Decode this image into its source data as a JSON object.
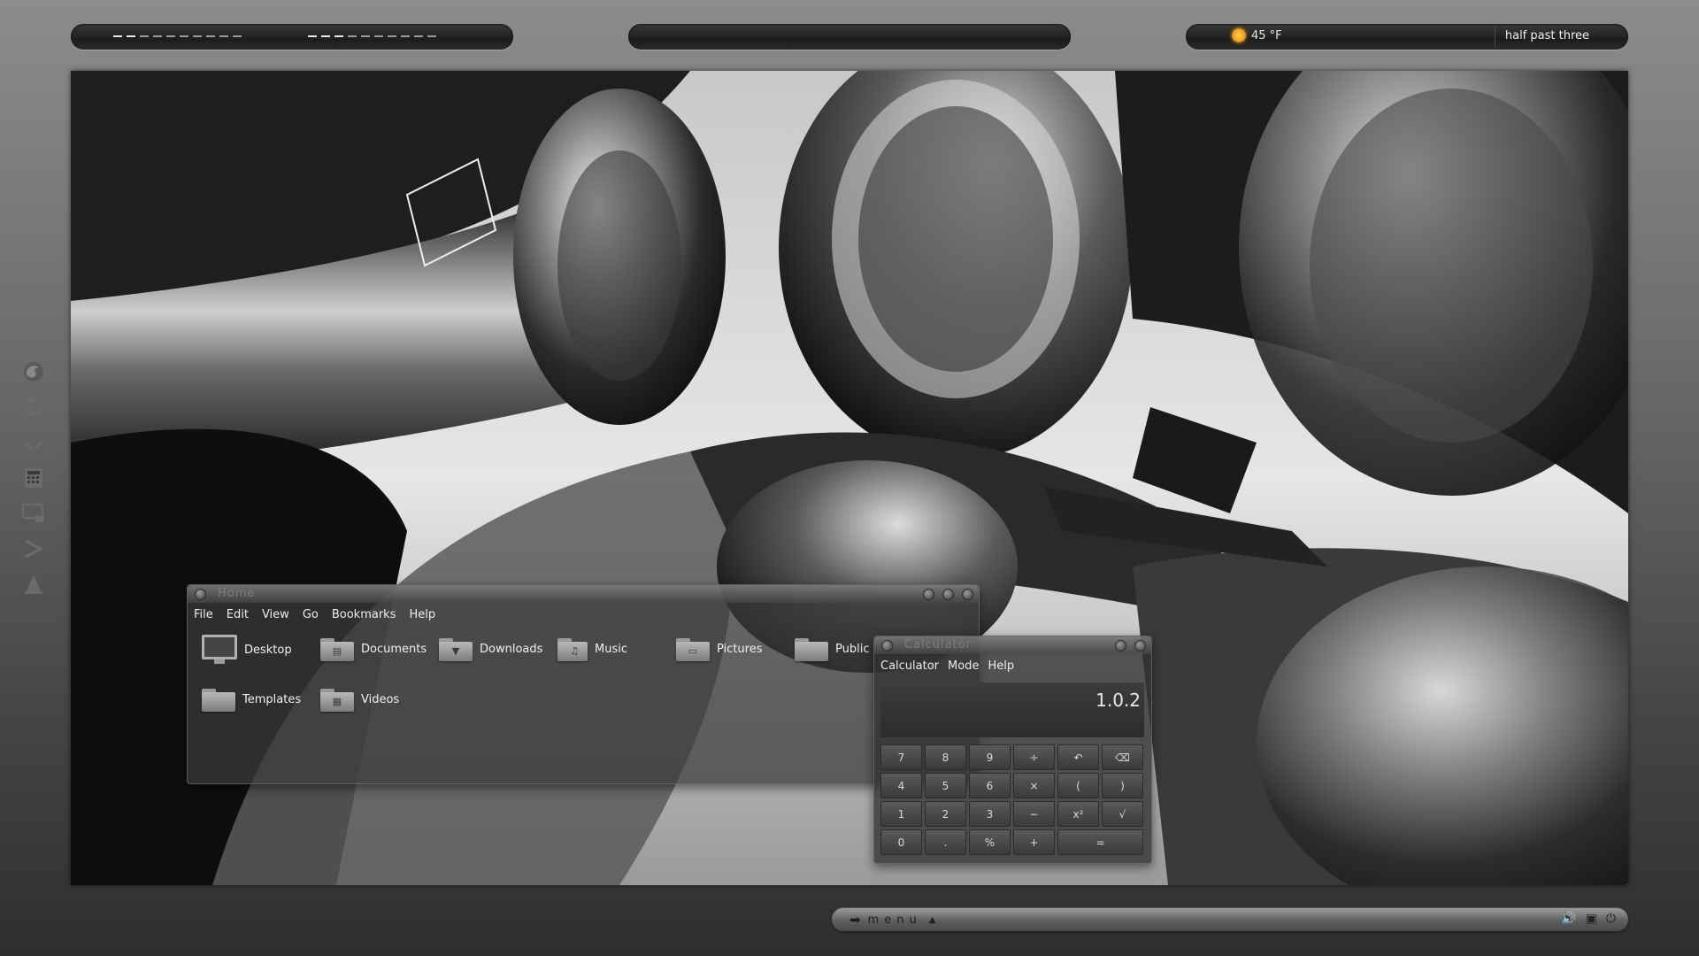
{
  "top_panel": {
    "weather": {
      "icon": "sun-icon",
      "temperature": "45 °F"
    },
    "clock": "half past three"
  },
  "dock": {
    "items": [
      {
        "name": "firefox-icon"
      },
      {
        "name": "update-icon"
      },
      {
        "name": "thunderbird-icon"
      },
      {
        "name": "calculator-icon"
      },
      {
        "name": "display-icon"
      },
      {
        "name": "terminal-icon"
      },
      {
        "name": "vlc-icon"
      }
    ]
  },
  "file_manager": {
    "title": "Home",
    "menu": [
      "File",
      "Edit",
      "View",
      "Go",
      "Bookmarks",
      "Help"
    ],
    "places": [
      {
        "label": "Desktop",
        "icon": "monitor-icon"
      },
      {
        "label": "Documents",
        "icon": "documents-folder-icon"
      },
      {
        "label": "Downloads",
        "icon": "downloads-folder-icon"
      },
      {
        "label": "Music",
        "icon": "music-folder-icon"
      },
      {
        "label": "Pictures",
        "icon": "pictures-folder-icon"
      },
      {
        "label": "Public",
        "icon": "public-folder-icon"
      },
      {
        "label": "Templates",
        "icon": "templates-folder-icon"
      },
      {
        "label": "Videos",
        "icon": "videos-folder-icon"
      }
    ]
  },
  "calculator": {
    "title": "Calculator",
    "menu": [
      "Calculator",
      "Mode",
      "Help"
    ],
    "display": "1.0.2",
    "keys": [
      "7",
      "8",
      "9",
      "÷",
      "↶",
      "⌫",
      "4",
      "5",
      "6",
      "×",
      "(",
      ")",
      "1",
      "2",
      "3",
      "−",
      "x²",
      "√",
      "0",
      ".",
      "%",
      "+",
      "="
    ]
  },
  "bottom_panel": {
    "menu_label": "menu",
    "tray": [
      "volume-icon",
      "network-icon",
      "power-icon"
    ]
  }
}
